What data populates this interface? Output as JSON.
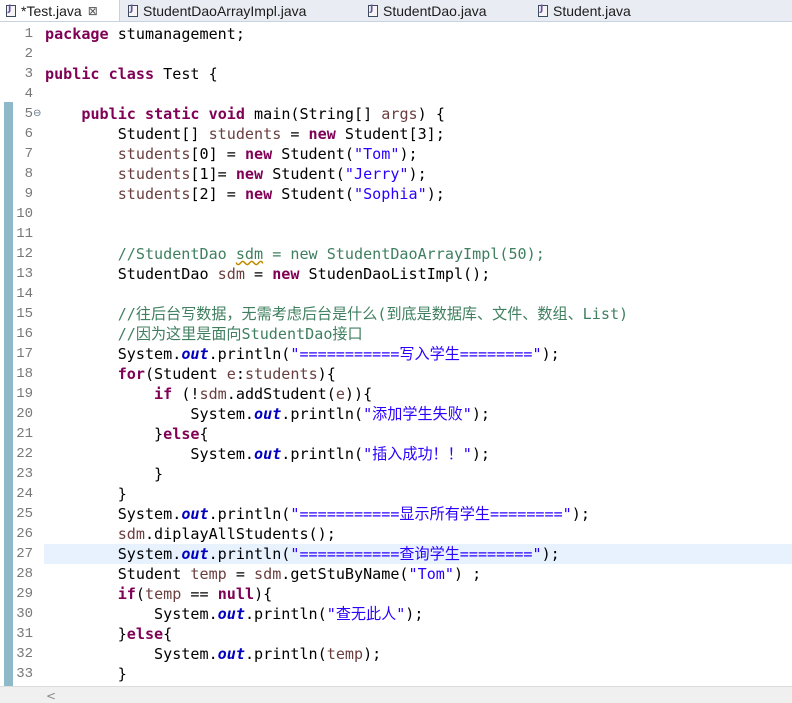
{
  "tabs": [
    {
      "label": "*Test.java",
      "active": true,
      "close": "⊠"
    },
    {
      "label": "StudentDaoArrayImpl.java",
      "active": false
    },
    {
      "label": "StudentDao.java",
      "active": false
    },
    {
      "label": "Student.java",
      "active": false
    }
  ],
  "editor": {
    "current_line": 27,
    "lines": [
      {
        "n": "1",
        "tokens": [
          [
            "kw",
            "package"
          ],
          [
            "t",
            " stumanagement;"
          ]
        ]
      },
      {
        "n": "2",
        "tokens": []
      },
      {
        "n": "3",
        "tokens": [
          [
            "kw",
            "public"
          ],
          [
            "t",
            " "
          ],
          [
            "kw",
            "class"
          ],
          [
            "t",
            " Test {"
          ]
        ]
      },
      {
        "n": "4",
        "tokens": []
      },
      {
        "n": "5",
        "fold": "⊖",
        "tokens": [
          [
            "t",
            "    "
          ],
          [
            "kw",
            "public"
          ],
          [
            "t",
            " "
          ],
          [
            "kw",
            "static"
          ],
          [
            "t",
            " "
          ],
          [
            "kw",
            "void"
          ],
          [
            "t",
            " main(String[] "
          ],
          [
            "var",
            "args"
          ],
          [
            "t",
            ") {"
          ]
        ]
      },
      {
        "n": "6",
        "tokens": [
          [
            "t",
            "        Student[] "
          ],
          [
            "var",
            "students"
          ],
          [
            "t",
            " = "
          ],
          [
            "kw",
            "new"
          ],
          [
            "t",
            " Student[3];"
          ]
        ]
      },
      {
        "n": "7",
        "tokens": [
          [
            "t",
            "        "
          ],
          [
            "var",
            "students"
          ],
          [
            "t",
            "[0] = "
          ],
          [
            "kw",
            "new"
          ],
          [
            "t",
            " Student("
          ],
          [
            "str",
            "\"Tom\""
          ],
          [
            "t",
            ");"
          ]
        ]
      },
      {
        "n": "8",
        "tokens": [
          [
            "t",
            "        "
          ],
          [
            "var",
            "students"
          ],
          [
            "t",
            "[1]= "
          ],
          [
            "kw",
            "new"
          ],
          [
            "t",
            " Student("
          ],
          [
            "str",
            "\"Jerry\""
          ],
          [
            "t",
            ");"
          ]
        ]
      },
      {
        "n": "9",
        "tokens": [
          [
            "t",
            "        "
          ],
          [
            "var",
            "students"
          ],
          [
            "t",
            "[2] = "
          ],
          [
            "kw",
            "new"
          ],
          [
            "t",
            " Student("
          ],
          [
            "str",
            "\"Sophia\""
          ],
          [
            "t",
            ");"
          ]
        ]
      },
      {
        "n": "10",
        "tokens": []
      },
      {
        "n": "11",
        "tokens": []
      },
      {
        "n": "12",
        "tokens": [
          [
            "cm",
            "        //StudentDao "
          ],
          [
            "cmw",
            "sdm"
          ],
          [
            "cm",
            " = new StudentDaoArrayImpl(50);"
          ]
        ]
      },
      {
        "n": "13",
        "tokens": [
          [
            "t",
            "        StudentDao "
          ],
          [
            "var",
            "sdm"
          ],
          [
            "t",
            " = "
          ],
          [
            "kw",
            "new"
          ],
          [
            "t",
            " StudenDaoListImpl();"
          ]
        ]
      },
      {
        "n": "14",
        "tokens": []
      },
      {
        "n": "15",
        "tokens": [
          [
            "cm",
            "        //往后台写数据，无需考虑后台是什么(到底是数据库、文件、数组、List)"
          ]
        ]
      },
      {
        "n": "16",
        "tokens": [
          [
            "cm",
            "        //因为这里是面向StudentDao接口"
          ]
        ]
      },
      {
        "n": "17",
        "tokens": [
          [
            "t",
            "        System."
          ],
          [
            "fld",
            "out"
          ],
          [
            "t",
            ".println("
          ],
          [
            "str",
            "\"===========写入学生========\""
          ],
          [
            "t",
            ");"
          ]
        ]
      },
      {
        "n": "18",
        "tokens": [
          [
            "t",
            "        "
          ],
          [
            "kw",
            "for"
          ],
          [
            "t",
            "(Student "
          ],
          [
            "var",
            "e"
          ],
          [
            "t",
            ":"
          ],
          [
            "var",
            "students"
          ],
          [
            "t",
            "){"
          ]
        ]
      },
      {
        "n": "19",
        "tokens": [
          [
            "t",
            "            "
          ],
          [
            "kw",
            "if"
          ],
          [
            "t",
            " (!"
          ],
          [
            "var",
            "sdm"
          ],
          [
            "t",
            ".addStudent("
          ],
          [
            "var",
            "e"
          ],
          [
            "t",
            ")){"
          ]
        ]
      },
      {
        "n": "20",
        "tokens": [
          [
            "t",
            "                System."
          ],
          [
            "fld",
            "out"
          ],
          [
            "t",
            ".println("
          ],
          [
            "str",
            "\"添加学生失败\""
          ],
          [
            "t",
            ");"
          ]
        ]
      },
      {
        "n": "21",
        "tokens": [
          [
            "t",
            "            }"
          ],
          [
            "kw",
            "else"
          ],
          [
            "t",
            "{"
          ]
        ]
      },
      {
        "n": "22",
        "tokens": [
          [
            "t",
            "                System."
          ],
          [
            "fld",
            "out"
          ],
          [
            "t",
            ".println("
          ],
          [
            "str",
            "\"插入成功！！\""
          ],
          [
            "t",
            ");"
          ]
        ]
      },
      {
        "n": "23",
        "tokens": [
          [
            "t",
            "            }"
          ]
        ]
      },
      {
        "n": "24",
        "tokens": [
          [
            "t",
            "        }"
          ]
        ]
      },
      {
        "n": "25",
        "tokens": [
          [
            "t",
            "        System."
          ],
          [
            "fld",
            "out"
          ],
          [
            "t",
            ".println("
          ],
          [
            "str",
            "\"===========显示所有学生========\""
          ],
          [
            "t",
            ");"
          ]
        ]
      },
      {
        "n": "26",
        "tokens": [
          [
            "t",
            "        "
          ],
          [
            "var",
            "sdm"
          ],
          [
            "t",
            ".diplayAllStudents();"
          ]
        ]
      },
      {
        "n": "27",
        "tokens": [
          [
            "t",
            "        System."
          ],
          [
            "fld",
            "out"
          ],
          [
            "t",
            ".println("
          ],
          [
            "str",
            "\"===========查询学生========\""
          ],
          [
            "t",
            ");"
          ]
        ]
      },
      {
        "n": "28",
        "tokens": [
          [
            "t",
            "        Student "
          ],
          [
            "var",
            "temp"
          ],
          [
            "t",
            " = "
          ],
          [
            "var",
            "sdm"
          ],
          [
            "t",
            ".getStuByName("
          ],
          [
            "str",
            "\"Tom\""
          ],
          [
            "t",
            ") ;"
          ]
        ]
      },
      {
        "n": "29",
        "tokens": [
          [
            "t",
            "        "
          ],
          [
            "kw",
            "if"
          ],
          [
            "t",
            "("
          ],
          [
            "var",
            "temp"
          ],
          [
            "t",
            " == "
          ],
          [
            "kw",
            "null"
          ],
          [
            "t",
            "){"
          ]
        ]
      },
      {
        "n": "30",
        "tokens": [
          [
            "t",
            "            System."
          ],
          [
            "fld",
            "out"
          ],
          [
            "t",
            ".println("
          ],
          [
            "str",
            "\"查无此人\""
          ],
          [
            "t",
            ");"
          ]
        ]
      },
      {
        "n": "31",
        "tokens": [
          [
            "t",
            "        }"
          ],
          [
            "kw",
            "else"
          ],
          [
            "t",
            "{"
          ]
        ]
      },
      {
        "n": "32",
        "tokens": [
          [
            "t",
            "            System."
          ],
          [
            "fld",
            "out"
          ],
          [
            "t",
            ".println("
          ],
          [
            "var",
            "temp"
          ],
          [
            "t",
            ");"
          ]
        ]
      },
      {
        "n": "33",
        "tokens": [
          [
            "t",
            "        }"
          ]
        ]
      }
    ]
  },
  "scrollbar": {
    "left_arrow": "<"
  }
}
